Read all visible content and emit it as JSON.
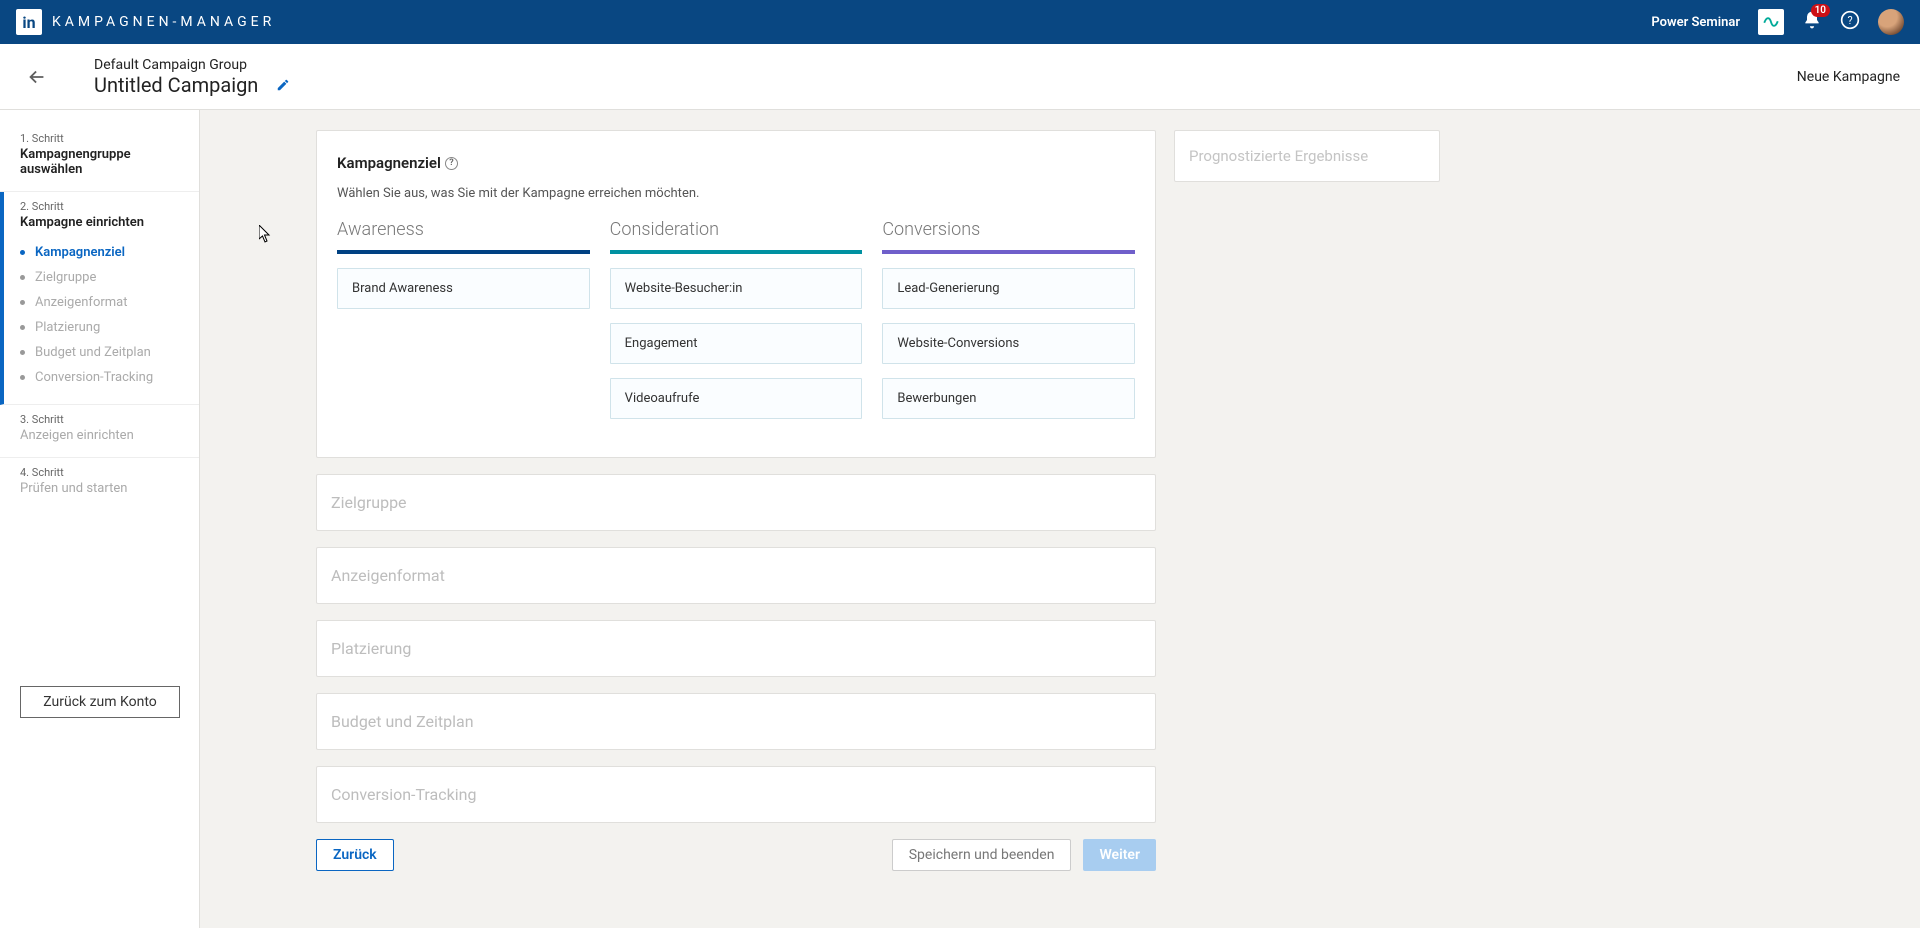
{
  "topbar": {
    "app_title": "KAMPAGNEN-MANAGER",
    "account": "Power Seminar",
    "notifications": "10"
  },
  "header": {
    "group": "Default Campaign Group",
    "campaign": "Untitled Campaign",
    "right_label": "Neue Kampagne"
  },
  "sidebar": {
    "step1_label": "1. Schritt",
    "step1_title": "Kampagnengruppe auswählen",
    "step2_label": "2. Schritt",
    "step2_title": "Kampagne einrichten",
    "sub": {
      "objective": "Kampagnenziel",
      "audience": "Zielgruppe",
      "format": "Anzeigenformat",
      "placement": "Platzierung",
      "budget": "Budget und Zeitplan",
      "conversion": "Conversion-Tracking"
    },
    "step3_label": "3. Schritt",
    "step3_title": "Anzeigen einrichten",
    "step4_label": "4. Schritt",
    "step4_title": "Prüfen und starten",
    "back_account": "Zurück zum Konto"
  },
  "objective": {
    "title": "Kampagnenziel",
    "subtitle": "Wählen Sie aus, was Sie mit der Kampagne erreichen möchten.",
    "columns": {
      "awareness": {
        "title": "Awareness",
        "options": [
          "Brand Awareness"
        ]
      },
      "consideration": {
        "title": "Consideration",
        "options": [
          "Website-Besucher:in",
          "Engagement",
          "Videoaufrufe"
        ]
      },
      "conversions": {
        "title": "Conversions",
        "options": [
          "Lead-Generierung",
          "Website-Conversions",
          "Bewerbungen"
        ]
      }
    }
  },
  "collapsed": {
    "audience": "Zielgruppe",
    "format": "Anzeigenformat",
    "placement": "Platzierung",
    "budget": "Budget und Zeitplan",
    "conversion": "Conversion-Tracking"
  },
  "buttons": {
    "back": "Zurück",
    "save_exit": "Speichern und beenden",
    "next": "Weiter"
  },
  "forecast": {
    "title": "Prognostizierte Ergebnisse"
  }
}
